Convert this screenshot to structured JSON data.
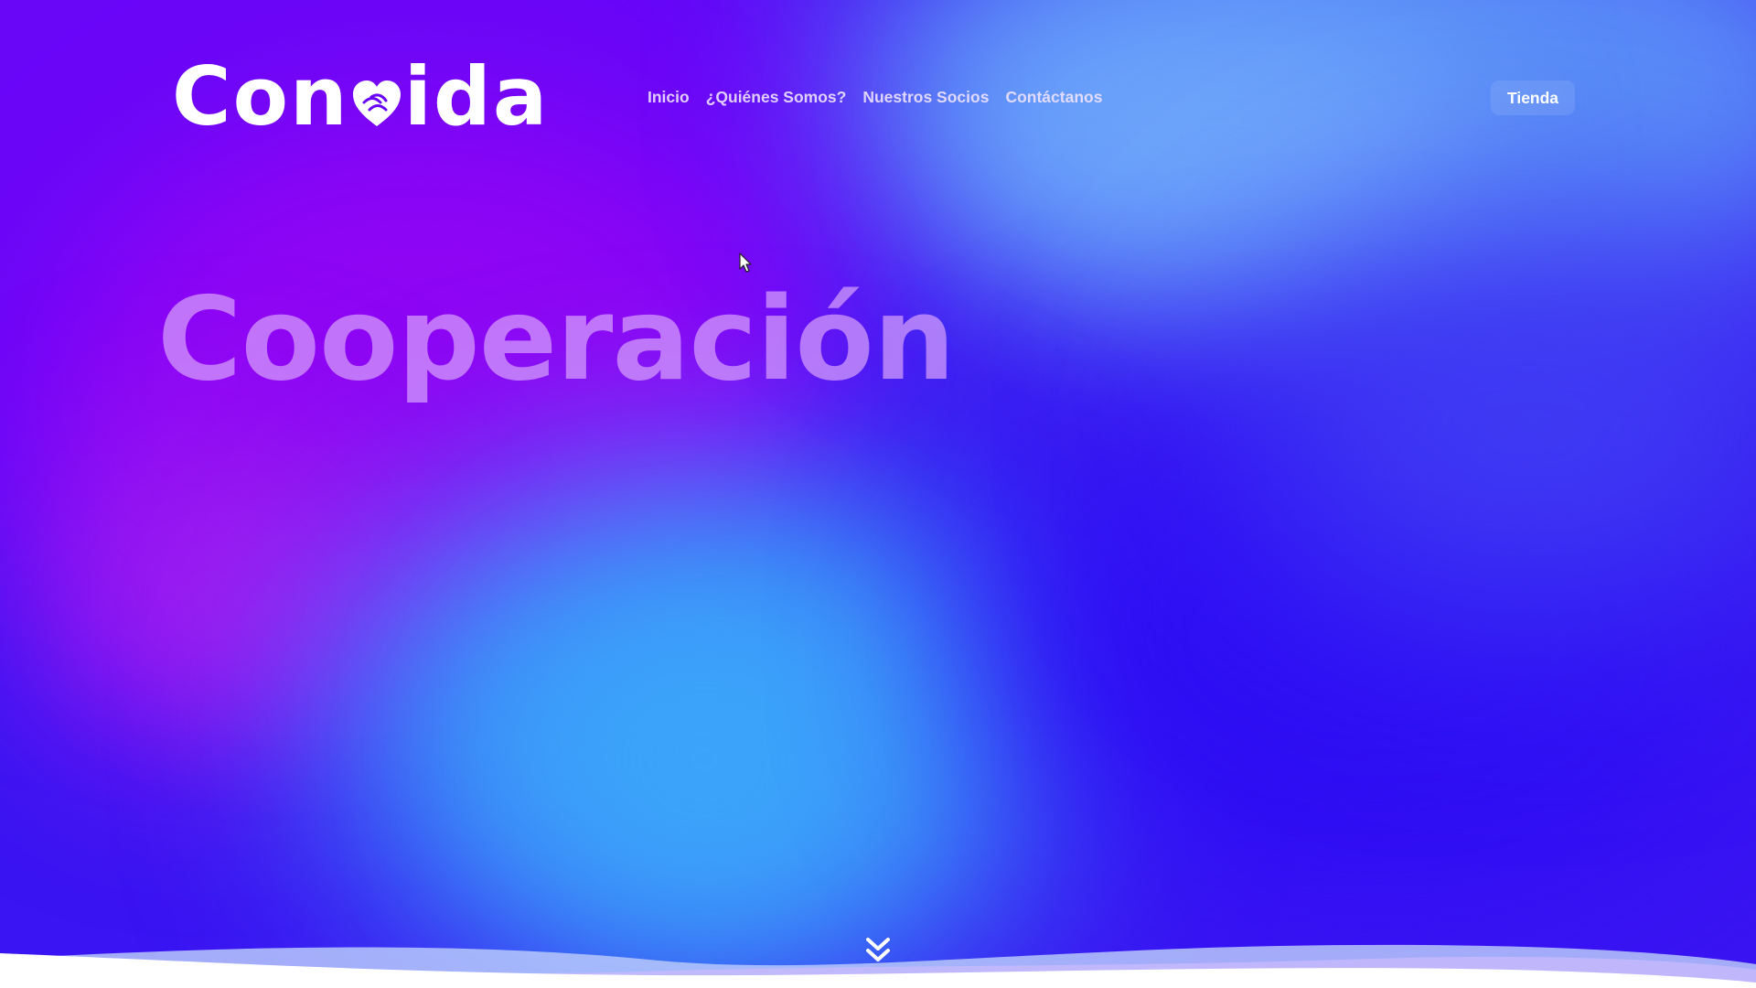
{
  "brand": {
    "logo_text_before": "Con",
    "logo_text_after": "ida",
    "logo_alt": "Convida"
  },
  "nav": {
    "items": [
      {
        "label": "Inicio"
      },
      {
        "label": "¿Quiénes Somos?"
      },
      {
        "label": "Nuestros Socios"
      },
      {
        "label": "Contáctanos"
      }
    ]
  },
  "header": {
    "shop_label": "Tienda"
  },
  "hero": {
    "headline": "Cooperación"
  },
  "icons": {
    "logo_heart": "heart-hands-icon",
    "scroll": "double-chevron-down-icon",
    "cursor": "mouse-pointer-icon"
  },
  "colors": {
    "primary_violet": "#6a06f8",
    "magenta": "#8e05f4",
    "sky_blue": "#3b98f8",
    "deep_blue": "#2d0cf4",
    "headline": "#d6a0fc",
    "white": "#ffffff"
  }
}
